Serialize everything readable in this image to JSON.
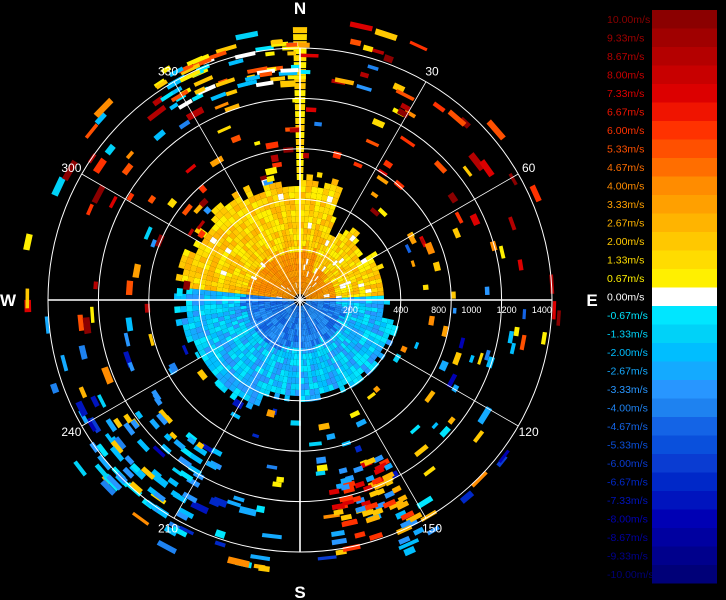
{
  "chart_data": {
    "type": "heatmap",
    "subtype": "polar radial velocity PPI",
    "compass_labels": [
      "N",
      "E",
      "S",
      "W"
    ],
    "bearing_labels": [
      "30",
      "60",
      "120",
      "150",
      "210",
      "240",
      "300",
      "330"
    ],
    "range_labels": [
      "200",
      "400",
      "800",
      "1000",
      "1200",
      "1400"
    ],
    "range_max": 1400,
    "unit": "m/s",
    "legend": {
      "labels": [
        "10.00m/s",
        "9.33m/s",
        "8.67m/s",
        "8.00m/s",
        "7.33m/s",
        "6.67m/s",
        "6.00m/s",
        "5.33m/s",
        "4.67m/s",
        "4.00m/s",
        "3.33m/s",
        "2.67m/s",
        "2.00m/s",
        "1.33m/s",
        "0.67m/s",
        "0.00m/s",
        "-0.67m/s",
        "-1.33m/s",
        "-2.00m/s",
        "-2.67m/s",
        "-3.33m/s",
        "-4.00m/s",
        "-4.67m/s",
        "-5.33m/s",
        "-6.00m/s",
        "-6.67m/s",
        "-7.33m/s",
        "-8.00m/s",
        "-8.67m/s",
        "-9.33m/s",
        "-10.00m/s"
      ],
      "colors": [
        "#8b0000",
        "#a00000",
        "#b40000",
        "#c80000",
        "#dc0000",
        "#f01400",
        "#ff3200",
        "#ff5000",
        "#ff6e00",
        "#ff8c00",
        "#ffa000",
        "#ffb400",
        "#ffc800",
        "#ffdc00",
        "#fff000",
        "#ffffff",
        "#00e6ff",
        "#00d2f8",
        "#00beff",
        "#14aaff",
        "#2896ff",
        "#1e82f0",
        "#1464e6",
        "#0a50dc",
        "#0a3cd2",
        "#0028c8",
        "#0014be",
        "#0000b4",
        "#0000a0",
        "#00008c",
        "#000078"
      ],
      "text_colors": [
        "#8b0000",
        "#a00000",
        "#b40000",
        "#c80000",
        "#dc0000",
        "#f01400",
        "#ff3200",
        "#ff5000",
        "#ff6e00",
        "#ff8c00",
        "#ffa000",
        "#ffb400",
        "#ffc800",
        "#ffdc00",
        "#fff000",
        "#ffffff",
        "#00e6ff",
        "#00d2f8",
        "#00beff",
        "#14aaff",
        "#2896ff",
        "#1e82f0",
        "#1464e6",
        "#0a50dc",
        "#0a3cd2",
        "#0028c8",
        "#0014be",
        "#0000b4",
        "#0000a0",
        "#00008c",
        "#000078"
      ]
    },
    "velocity_pattern": [
      {
        "az_from": 0,
        "az_to": 360,
        "r_from": 0,
        "r_to": 580,
        "sector": "north",
        "value_range": [
          0.67,
          4.0
        ]
      },
      {
        "az_from": 90,
        "az_to": 270,
        "r_from": 0,
        "r_to": 580,
        "sector": "south",
        "value_range": [
          -4.67,
          -0.67
        ]
      }
    ]
  }
}
